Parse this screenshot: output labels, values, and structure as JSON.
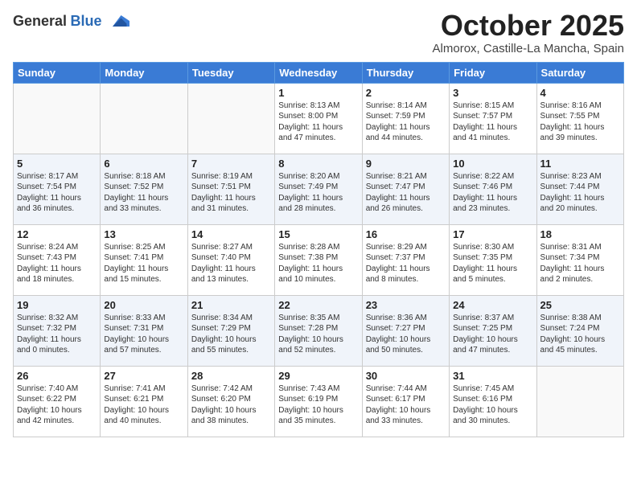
{
  "logo": {
    "general": "General",
    "blue": "Blue"
  },
  "header": {
    "month": "October 2025",
    "location": "Almorox, Castille-La Mancha, Spain"
  },
  "weekdays": [
    "Sunday",
    "Monday",
    "Tuesday",
    "Wednesday",
    "Thursday",
    "Friday",
    "Saturday"
  ],
  "weeks": [
    [
      {
        "day": "",
        "info": ""
      },
      {
        "day": "",
        "info": ""
      },
      {
        "day": "",
        "info": ""
      },
      {
        "day": "1",
        "info": "Sunrise: 8:13 AM\nSunset: 8:00 PM\nDaylight: 11 hours\nand 47 minutes."
      },
      {
        "day": "2",
        "info": "Sunrise: 8:14 AM\nSunset: 7:59 PM\nDaylight: 11 hours\nand 44 minutes."
      },
      {
        "day": "3",
        "info": "Sunrise: 8:15 AM\nSunset: 7:57 PM\nDaylight: 11 hours\nand 41 minutes."
      },
      {
        "day": "4",
        "info": "Sunrise: 8:16 AM\nSunset: 7:55 PM\nDaylight: 11 hours\nand 39 minutes."
      }
    ],
    [
      {
        "day": "5",
        "info": "Sunrise: 8:17 AM\nSunset: 7:54 PM\nDaylight: 11 hours\nand 36 minutes."
      },
      {
        "day": "6",
        "info": "Sunrise: 8:18 AM\nSunset: 7:52 PM\nDaylight: 11 hours\nand 33 minutes."
      },
      {
        "day": "7",
        "info": "Sunrise: 8:19 AM\nSunset: 7:51 PM\nDaylight: 11 hours\nand 31 minutes."
      },
      {
        "day": "8",
        "info": "Sunrise: 8:20 AM\nSunset: 7:49 PM\nDaylight: 11 hours\nand 28 minutes."
      },
      {
        "day": "9",
        "info": "Sunrise: 8:21 AM\nSunset: 7:47 PM\nDaylight: 11 hours\nand 26 minutes."
      },
      {
        "day": "10",
        "info": "Sunrise: 8:22 AM\nSunset: 7:46 PM\nDaylight: 11 hours\nand 23 minutes."
      },
      {
        "day": "11",
        "info": "Sunrise: 8:23 AM\nSunset: 7:44 PM\nDaylight: 11 hours\nand 20 minutes."
      }
    ],
    [
      {
        "day": "12",
        "info": "Sunrise: 8:24 AM\nSunset: 7:43 PM\nDaylight: 11 hours\nand 18 minutes."
      },
      {
        "day": "13",
        "info": "Sunrise: 8:25 AM\nSunset: 7:41 PM\nDaylight: 11 hours\nand 15 minutes."
      },
      {
        "day": "14",
        "info": "Sunrise: 8:27 AM\nSunset: 7:40 PM\nDaylight: 11 hours\nand 13 minutes."
      },
      {
        "day": "15",
        "info": "Sunrise: 8:28 AM\nSunset: 7:38 PM\nDaylight: 11 hours\nand 10 minutes."
      },
      {
        "day": "16",
        "info": "Sunrise: 8:29 AM\nSunset: 7:37 PM\nDaylight: 11 hours\nand 8 minutes."
      },
      {
        "day": "17",
        "info": "Sunrise: 8:30 AM\nSunset: 7:35 PM\nDaylight: 11 hours\nand 5 minutes."
      },
      {
        "day": "18",
        "info": "Sunrise: 8:31 AM\nSunset: 7:34 PM\nDaylight: 11 hours\nand 2 minutes."
      }
    ],
    [
      {
        "day": "19",
        "info": "Sunrise: 8:32 AM\nSunset: 7:32 PM\nDaylight: 11 hours\nand 0 minutes."
      },
      {
        "day": "20",
        "info": "Sunrise: 8:33 AM\nSunset: 7:31 PM\nDaylight: 10 hours\nand 57 minutes."
      },
      {
        "day": "21",
        "info": "Sunrise: 8:34 AM\nSunset: 7:29 PM\nDaylight: 10 hours\nand 55 minutes."
      },
      {
        "day": "22",
        "info": "Sunrise: 8:35 AM\nSunset: 7:28 PM\nDaylight: 10 hours\nand 52 minutes."
      },
      {
        "day": "23",
        "info": "Sunrise: 8:36 AM\nSunset: 7:27 PM\nDaylight: 10 hours\nand 50 minutes."
      },
      {
        "day": "24",
        "info": "Sunrise: 8:37 AM\nSunset: 7:25 PM\nDaylight: 10 hours\nand 47 minutes."
      },
      {
        "day": "25",
        "info": "Sunrise: 8:38 AM\nSunset: 7:24 PM\nDaylight: 10 hours\nand 45 minutes."
      }
    ],
    [
      {
        "day": "26",
        "info": "Sunrise: 7:40 AM\nSunset: 6:22 PM\nDaylight: 10 hours\nand 42 minutes."
      },
      {
        "day": "27",
        "info": "Sunrise: 7:41 AM\nSunset: 6:21 PM\nDaylight: 10 hours\nand 40 minutes."
      },
      {
        "day": "28",
        "info": "Sunrise: 7:42 AM\nSunset: 6:20 PM\nDaylight: 10 hours\nand 38 minutes."
      },
      {
        "day": "29",
        "info": "Sunrise: 7:43 AM\nSunset: 6:19 PM\nDaylight: 10 hours\nand 35 minutes."
      },
      {
        "day": "30",
        "info": "Sunrise: 7:44 AM\nSunset: 6:17 PM\nDaylight: 10 hours\nand 33 minutes."
      },
      {
        "day": "31",
        "info": "Sunrise: 7:45 AM\nSunset: 6:16 PM\nDaylight: 10 hours\nand 30 minutes."
      },
      {
        "day": "",
        "info": ""
      }
    ]
  ]
}
